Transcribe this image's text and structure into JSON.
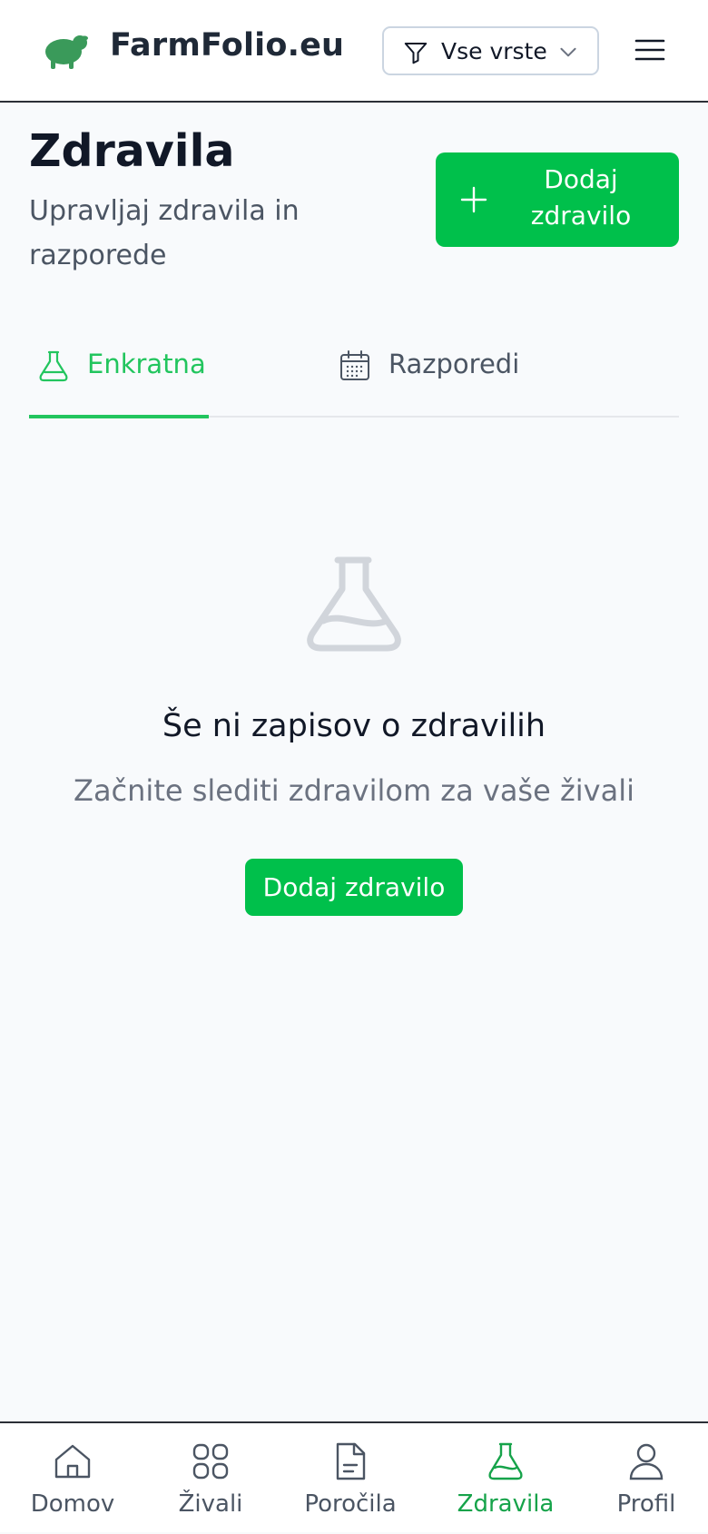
{
  "header": {
    "brand": "FarmFolio.eu",
    "logo_icon": "sheep-icon",
    "filter_label": "Vse vrste",
    "menu_icon": "hamburger-menu-icon"
  },
  "page": {
    "title": "Zdravila",
    "subtitle": "Upravljaj zdravila in razporede",
    "add_button_label": "Dodaj zdravilo"
  },
  "tabs": [
    {
      "label": "Enkratna",
      "icon": "flask-icon",
      "active": true
    },
    {
      "label": "Razporedi",
      "icon": "calendar-icon",
      "active": false
    }
  ],
  "empty_state": {
    "icon": "flask-icon",
    "title": "Še ni zapisov o zdravilih",
    "description": "Začnite slediti zdravilom za vaše živali",
    "button_label": "Dodaj zdravilo"
  },
  "bottom_nav": [
    {
      "label": "Domov",
      "icon": "home-icon",
      "active": false
    },
    {
      "label": "Živali",
      "icon": "grid-icon",
      "active": false
    },
    {
      "label": "Poročila",
      "icon": "document-icon",
      "active": false
    },
    {
      "label": "Zdravila",
      "icon": "flask-icon",
      "active": true
    },
    {
      "label": "Profil",
      "icon": "user-icon",
      "active": false
    }
  ],
  "colors": {
    "accent": "#00c04b",
    "active_tab": "#22c55e",
    "brand_logo": "#3a9a5a",
    "background": "#f8fafc"
  }
}
